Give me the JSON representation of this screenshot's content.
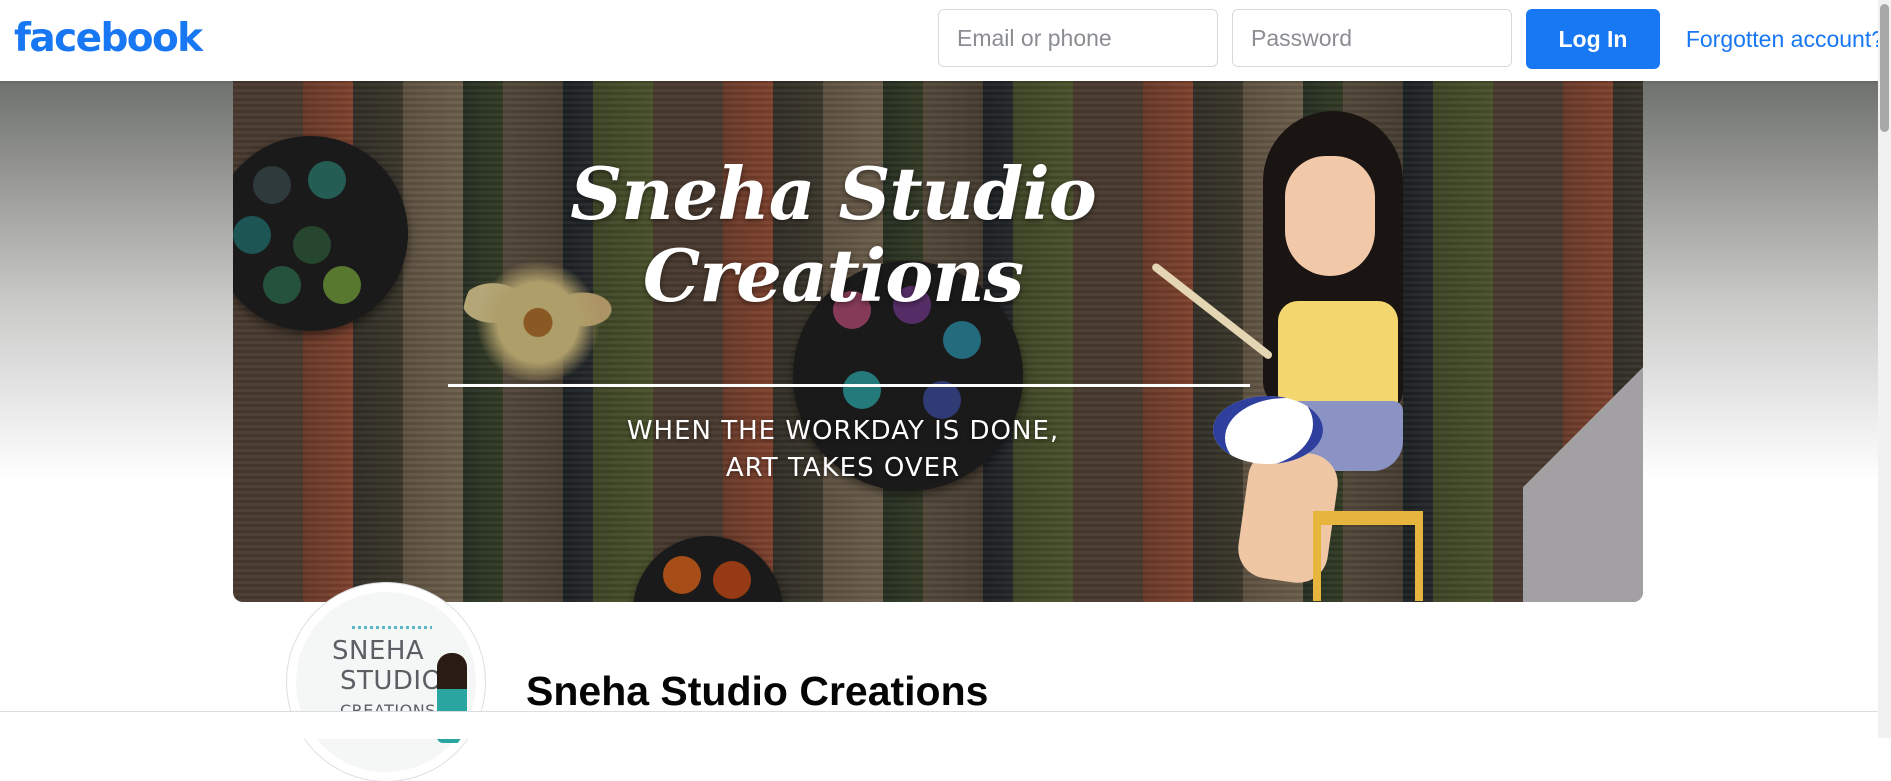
{
  "header": {
    "logo_text": "facebook",
    "email_placeholder": "Email or phone",
    "password_placeholder": "Password",
    "login_label": "Log In",
    "forgot_label": "Forgotten account?"
  },
  "cover": {
    "title": "Sneha Studio Creations",
    "tagline_line1": "WHEN THE WORKDAY IS DONE,",
    "tagline_line2": "ART TAKES OVER"
  },
  "profile": {
    "avatar_text_line1": "SNEHA",
    "avatar_text_line2": "STUDIO",
    "avatar_text_line3": "CREATIONS",
    "page_name": "Sneha Studio Creations"
  },
  "colors": {
    "brand": "#1877f2",
    "text": "#050505"
  }
}
